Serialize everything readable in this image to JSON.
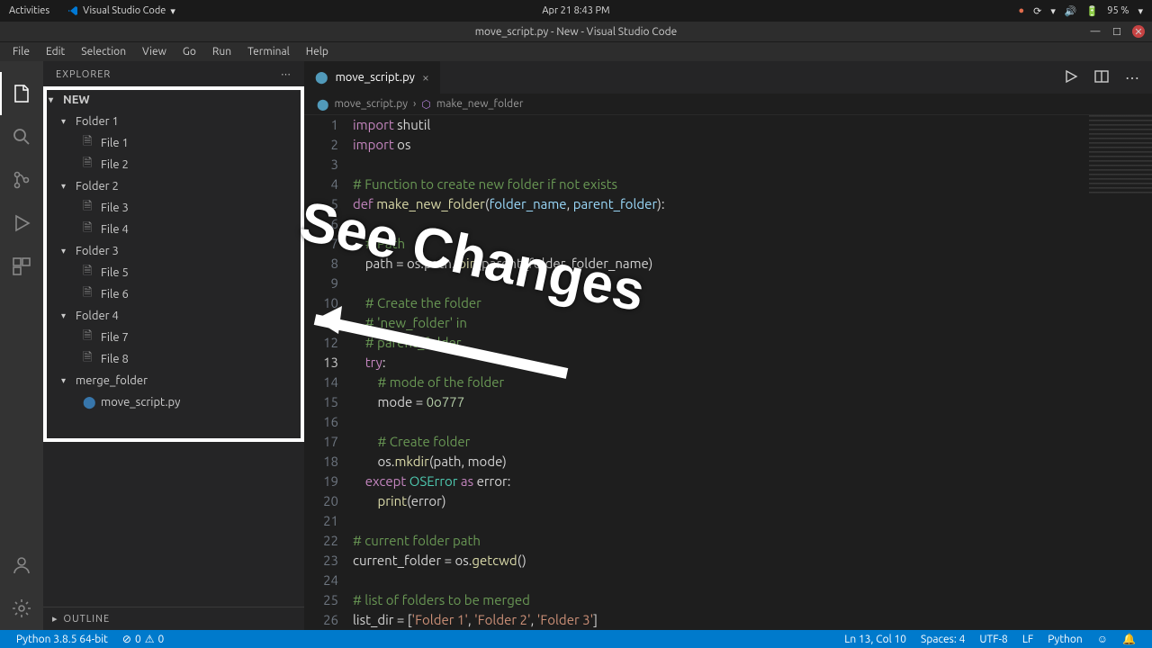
{
  "gnome": {
    "activities": "Activities",
    "app": "Visual Studio Code",
    "datetime": "Apr 21  8:43 PM",
    "battery": "95 %"
  },
  "window": {
    "title": "move_script.py - New - Visual Studio Code"
  },
  "menu": [
    "File",
    "Edit",
    "Selection",
    "View",
    "Go",
    "Run",
    "Terminal",
    "Help"
  ],
  "explorer": {
    "title": "EXPLORER",
    "root": "NEW",
    "tree": [
      {
        "type": "folder",
        "name": "Folder 1"
      },
      {
        "type": "file",
        "name": "File 1"
      },
      {
        "type": "file",
        "name": "File 2"
      },
      {
        "type": "folder",
        "name": "Folder 2"
      },
      {
        "type": "file",
        "name": "File 3"
      },
      {
        "type": "file",
        "name": "File 4"
      },
      {
        "type": "folder",
        "name": "Folder 3"
      },
      {
        "type": "file",
        "name": "File 5"
      },
      {
        "type": "file",
        "name": "File 6"
      },
      {
        "type": "folder",
        "name": "Folder 4"
      },
      {
        "type": "file",
        "name": "File 7"
      },
      {
        "type": "file",
        "name": "File 8"
      },
      {
        "type": "folder",
        "name": "merge_folder"
      },
      {
        "type": "pyfile",
        "name": "move_script.py"
      }
    ],
    "outline": "OUTLINE"
  },
  "tab": {
    "name": "move_script.py"
  },
  "breadcrumb": {
    "file": "move_script.py",
    "symbol": "make_new_folder"
  },
  "code": {
    "lines": [
      {
        "n": 1,
        "seg": [
          [
            "kw",
            "import"
          ],
          [
            "op",
            " shutil"
          ]
        ]
      },
      {
        "n": 2,
        "seg": [
          [
            "kw",
            "import"
          ],
          [
            "op",
            " os"
          ]
        ]
      },
      {
        "n": 3,
        "seg": [
          [
            "op",
            ""
          ]
        ]
      },
      {
        "n": 4,
        "seg": [
          [
            "cm",
            "# Function to create new folder if not exists"
          ]
        ]
      },
      {
        "n": 5,
        "seg": [
          [
            "kw",
            "def "
          ],
          [
            "fn",
            "make_new_folder"
          ],
          [
            "op",
            "("
          ],
          [
            "par",
            "folder_name"
          ],
          [
            "op",
            ", "
          ],
          [
            "par",
            "parent_folder"
          ],
          [
            "op",
            "):"
          ]
        ]
      },
      {
        "n": 6,
        "seg": [
          [
            "op",
            ""
          ]
        ]
      },
      {
        "n": 7,
        "seg": [
          [
            "op",
            "    "
          ],
          [
            "cm",
            "# Path"
          ]
        ]
      },
      {
        "n": 8,
        "seg": [
          [
            "op",
            "    path = os.path."
          ],
          [
            "fn",
            "join"
          ],
          [
            "op",
            "(parent_folder, folder_name)"
          ]
        ]
      },
      {
        "n": 9,
        "seg": [
          [
            "op",
            ""
          ]
        ]
      },
      {
        "n": 10,
        "seg": [
          [
            "op",
            "    "
          ],
          [
            "cm",
            "# Create the folder"
          ]
        ]
      },
      {
        "n": 11,
        "seg": [
          [
            "op",
            "    "
          ],
          [
            "cm",
            "# 'new_folder' in"
          ]
        ]
      },
      {
        "n": 12,
        "seg": [
          [
            "op",
            "    "
          ],
          [
            "cm",
            "# parent_folder"
          ]
        ]
      },
      {
        "n": 13,
        "seg": [
          [
            "op",
            "    "
          ],
          [
            "kw",
            "try"
          ],
          [
            "op",
            ":"
          ]
        ]
      },
      {
        "n": 14,
        "seg": [
          [
            "op",
            "        "
          ],
          [
            "cm",
            "# mode of the folder"
          ]
        ]
      },
      {
        "n": 15,
        "seg": [
          [
            "op",
            "        mode = "
          ],
          [
            "nm",
            "0o777"
          ]
        ]
      },
      {
        "n": 16,
        "seg": [
          [
            "op",
            ""
          ]
        ]
      },
      {
        "n": 17,
        "seg": [
          [
            "op",
            "        "
          ],
          [
            "cm",
            "# Create folder"
          ]
        ]
      },
      {
        "n": 18,
        "seg": [
          [
            "op",
            "        os."
          ],
          [
            "fn",
            "mkdir"
          ],
          [
            "op",
            "(path, mode)"
          ]
        ]
      },
      {
        "n": 19,
        "seg": [
          [
            "op",
            "    "
          ],
          [
            "kw",
            "except"
          ],
          [
            "op",
            " "
          ],
          [
            "cls",
            "OSError"
          ],
          [
            "op",
            " "
          ],
          [
            "kw",
            "as"
          ],
          [
            "op",
            " error:"
          ]
        ]
      },
      {
        "n": 20,
        "seg": [
          [
            "op",
            "        "
          ],
          [
            "fn",
            "print"
          ],
          [
            "op",
            "(error)"
          ]
        ]
      },
      {
        "n": 21,
        "seg": [
          [
            "op",
            ""
          ]
        ]
      },
      {
        "n": 22,
        "seg": [
          [
            "cm",
            "# current folder path"
          ]
        ]
      },
      {
        "n": 23,
        "seg": [
          [
            "op",
            "current_folder = os."
          ],
          [
            "fn",
            "getcwd"
          ],
          [
            "op",
            "()"
          ]
        ]
      },
      {
        "n": 24,
        "seg": [
          [
            "op",
            ""
          ]
        ]
      },
      {
        "n": 25,
        "seg": [
          [
            "cm",
            "# list of folders to be merged"
          ]
        ]
      },
      {
        "n": 26,
        "seg": [
          [
            "op",
            "list_dir = ["
          ],
          [
            "st",
            "'Folder 1'"
          ],
          [
            "op",
            ", "
          ],
          [
            "st",
            "'Folder 2'"
          ],
          [
            "op",
            ", "
          ],
          [
            "st",
            "'Folder 3'"
          ],
          [
            "op",
            "]"
          ]
        ]
      }
    ],
    "active_line": 13
  },
  "status": {
    "python": "Python 3.8.5 64-bit",
    "errors": "0",
    "warnings": "0",
    "cursor": "Ln 13, Col 10",
    "spaces": "Spaces: 4",
    "encoding": "UTF-8",
    "eol": "LF",
    "lang": "Python"
  },
  "annotation": "See Changes"
}
